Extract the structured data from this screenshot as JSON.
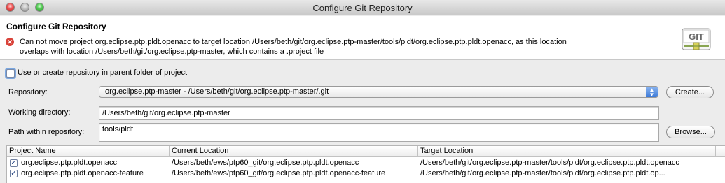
{
  "window": {
    "title": "Configure Git Repository"
  },
  "header": {
    "title": "Configure Git Repository",
    "error_line1": "Can not move project org.eclipse.ptp.pldt.openacc to target location /Users/beth/git/org.eclipse.ptp-master/tools/pldt/org.eclipse.ptp.pldt.openacc, as this location",
    "error_line2": "overlaps with location /Users/beth/git/org.eclipse.ptp-master, which contains a .project file",
    "logo_text": "GIT"
  },
  "parent_repo": {
    "label": "Use or create repository in parent folder of project",
    "checked": false
  },
  "repository": {
    "label": "Repository:",
    "value": "org.eclipse.ptp-master - /Users/beth/git/org.eclipse.ptp-master/.git",
    "create_button": "Create..."
  },
  "working_dir": {
    "label": "Working directory:",
    "value": "/Users/beth/git/org.eclipse.ptp-master"
  },
  "path_within": {
    "label": "Path within repository:",
    "value": "tools/pldt",
    "browse_button": "Browse..."
  },
  "table": {
    "headers": [
      "Project Name",
      "Current Location",
      "Target Location"
    ],
    "rows": [
      {
        "checked": true,
        "name": "org.eclipse.ptp.pldt.openacc",
        "current": "/Users/beth/ews/ptp60_git/org.eclipse.ptp.pldt.openacc",
        "target": "/Users/beth/git/org.eclipse.ptp-master/tools/pldt/org.eclipse.ptp.pldt.openacc"
      },
      {
        "checked": true,
        "name": "org.eclipse.ptp.pldt.openacc-feature",
        "current": "/Users/beth/ews/ptp60_git/org.eclipse.ptp.pldt.openacc-feature",
        "target": "/Users/beth/git/org.eclipse.ptp-master/tools/pldt/org.eclipse.ptp.pldt.op..."
      }
    ]
  },
  "colors": {
    "error": "#d9433a",
    "combo_arrow": "#3d7ad8",
    "focus_ring": "#7aa7e0"
  }
}
